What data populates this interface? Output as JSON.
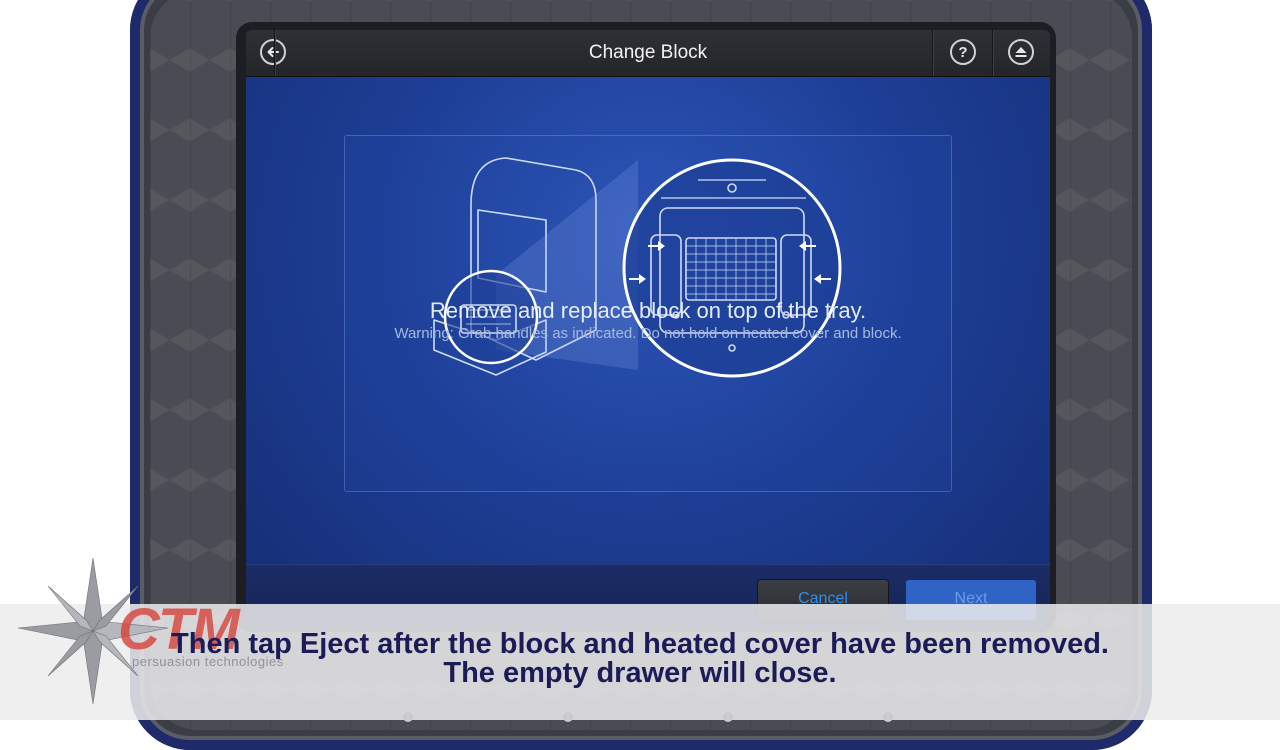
{
  "header": {
    "title": "Change Block",
    "back_icon": "arrow-left-icon",
    "help_label": "?",
    "eject_icon": "eject-icon"
  },
  "content": {
    "instruction": "Remove and replace block on top of the tray.",
    "warning": "Warning: Grab handles as indicated. Do not hold on heated cover and block."
  },
  "footer": {
    "cancel_label": "Cancel",
    "next_label": "Next"
  },
  "overlay": {
    "caption_line1": "Then tap Eject after the block and heated cover have been removed.",
    "caption_line2": "The empty drawer will close.",
    "logo_text": "CTM",
    "logo_tagline": "persuasion technologies"
  },
  "colors": {
    "screen_blue": "#1e3f97",
    "caption_navy": "#1b1c57",
    "logo_red": "#d6423a",
    "cancel_text": "#2f8fe8"
  }
}
